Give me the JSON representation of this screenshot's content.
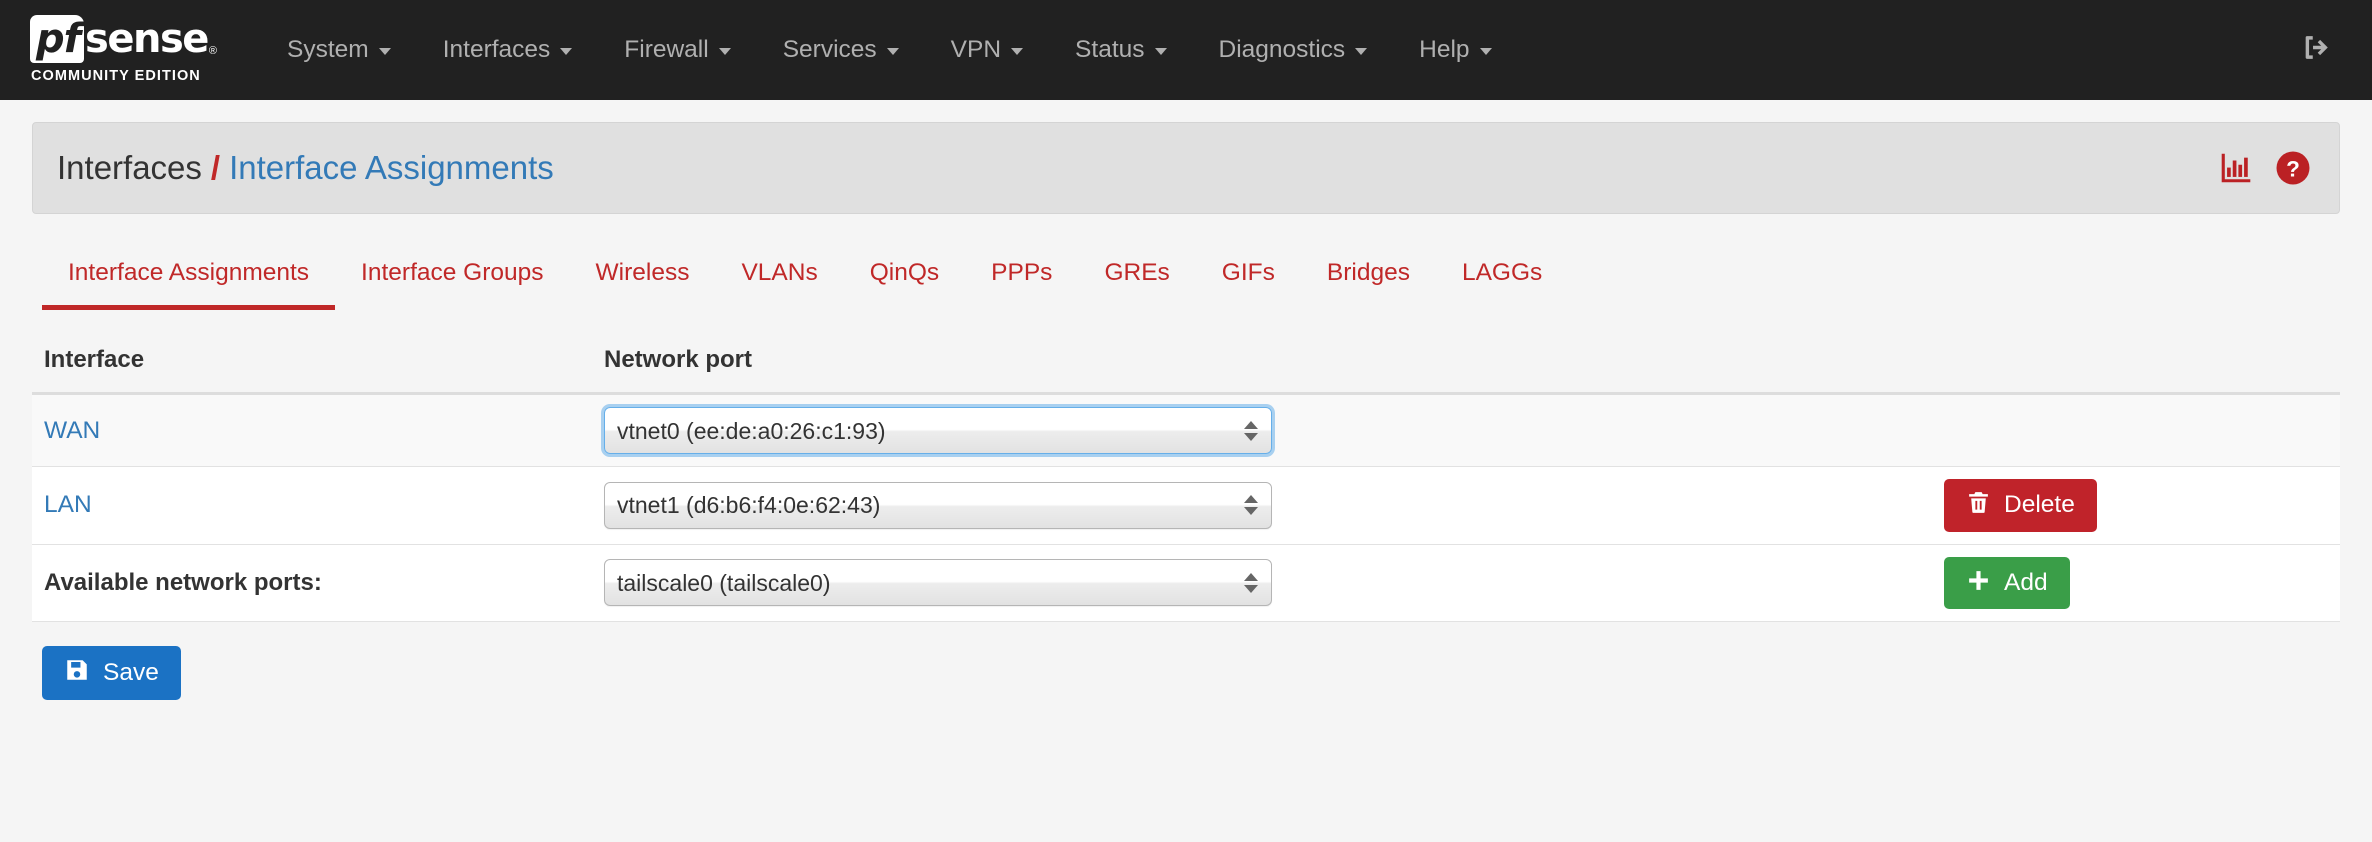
{
  "brand": {
    "pf": "pf",
    "sense": "sense",
    "registered": "®",
    "subtitle": "COMMUNITY EDITION"
  },
  "navbar": {
    "items": [
      {
        "label": "System",
        "icon": "chevron-down-icon"
      },
      {
        "label": "Interfaces",
        "icon": "chevron-down-icon"
      },
      {
        "label": "Firewall",
        "icon": "chevron-down-icon"
      },
      {
        "label": "Services",
        "icon": "chevron-down-icon"
      },
      {
        "label": "VPN",
        "icon": "chevron-down-icon"
      },
      {
        "label": "Status",
        "icon": "chevron-down-icon"
      },
      {
        "label": "Diagnostics",
        "icon": "chevron-down-icon"
      },
      {
        "label": "Help",
        "icon": "chevron-down-icon"
      }
    ],
    "logout_icon": "sign-out-icon"
  },
  "page_header": {
    "breadcrumb_root": "Interfaces",
    "breadcrumb_separator": "/",
    "breadcrumb_current": "Interface Assignments",
    "stats_icon": "bar-chart-icon",
    "help_icon": "question-circle-icon"
  },
  "tabs": [
    {
      "label": "Interface Assignments",
      "active": true
    },
    {
      "label": "Interface Groups",
      "active": false
    },
    {
      "label": "Wireless",
      "active": false
    },
    {
      "label": "VLANs",
      "active": false
    },
    {
      "label": "QinQs",
      "active": false
    },
    {
      "label": "PPPs",
      "active": false
    },
    {
      "label": "GREs",
      "active": false
    },
    {
      "label": "GIFs",
      "active": false
    },
    {
      "label": "Bridges",
      "active": false
    },
    {
      "label": "LAGGs",
      "active": false
    }
  ],
  "table": {
    "headers": {
      "interface": "Interface",
      "network_port": "Network port"
    },
    "rows": [
      {
        "interface": "WAN",
        "port_value": "vtnet0 (ee:de:a0:26:c1:93)",
        "focused": true,
        "action": null
      },
      {
        "interface": "LAN",
        "port_value": "vtnet1 (d6:b6:f4:0e:62:43)",
        "focused": false,
        "action": {
          "label": "Delete",
          "icon": "trash-icon",
          "style": "danger"
        }
      }
    ],
    "available": {
      "label": "Available network ports:",
      "port_value": "tailscale0 (tailscale0)",
      "action": {
        "label": "Add",
        "icon": "plus-icon",
        "style": "success"
      }
    }
  },
  "save_button": {
    "label": "Save",
    "icon": "save-icon"
  },
  "colors": {
    "navbar_bg": "#212121",
    "accent_red": "#c02828",
    "link_blue": "#337ab7",
    "danger": "#c0232a",
    "success": "#3a9e48",
    "primary": "#1b72c4"
  }
}
